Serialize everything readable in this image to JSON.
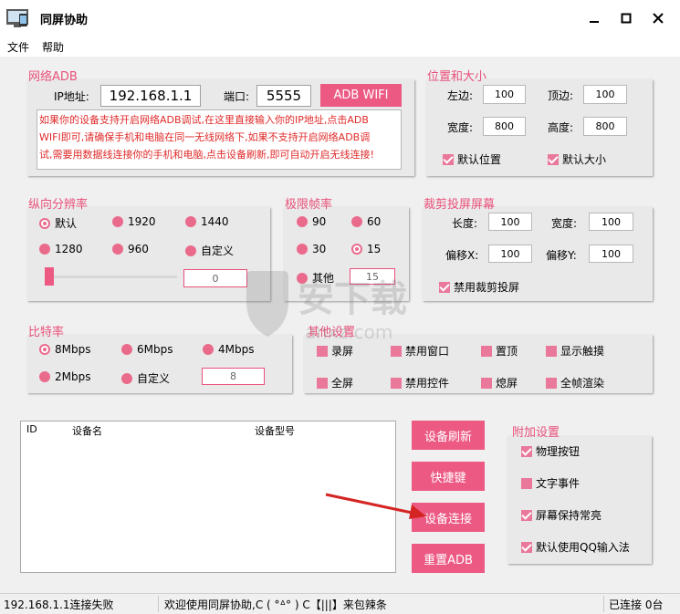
{
  "window": {
    "title": "同屏协助"
  },
  "menu": {
    "file": "文件",
    "help": "帮助"
  },
  "adb": {
    "title": "网络ADB",
    "ip_label": "IP地址:",
    "ip_value": "192.168.1.1",
    "port_label": "端口:",
    "port_value": "5555",
    "button": "ADB WIFI",
    "notice_lines": [
      "如果你的设备支持开启网络ADB调试,在这里直接输入你的IP地址,点击ADB",
      "WIFI即可,请确保手机和电脑在同一无线网络下,如果不支持开启网络ADB调",
      "试,需要用数据线连接你的手机和电脑,点击设备刷新,即可自动开启无线连接!"
    ]
  },
  "position": {
    "title": "位置和大小",
    "left_label": "左边:",
    "left_value": "100",
    "top_label": "顶边:",
    "top_value": "100",
    "width_label": "宽度:",
    "width_value": "800",
    "height_label": "高度:",
    "height_value": "800",
    "default_position": "默认位置",
    "default_size": "默认大小"
  },
  "resolution": {
    "title": "纵向分辨率",
    "options": [
      "默认",
      "1920",
      "1440",
      "1280",
      "960",
      "自定义"
    ],
    "selected": "默认",
    "custom_value": "0",
    "slider_fraction": 0
  },
  "fps": {
    "title": "极限帧率",
    "options": [
      "90",
      "60",
      "30",
      "15",
      "其他"
    ],
    "selected": "15",
    "custom_value": "15"
  },
  "crop": {
    "title": "裁剪投屏屏幕",
    "length_label": "长度:",
    "length_value": "100",
    "width_label": "宽度:",
    "width_value": "100",
    "offsetx_label": "偏移X:",
    "offsetx_value": "100",
    "offsety_label": "偏移Y:",
    "offsety_value": "100",
    "disable_crop": "禁用裁剪投屏"
  },
  "bitrate": {
    "title": "比特率",
    "options": [
      "8Mbps",
      "6Mbps",
      "4Mbps",
      "2Mbps",
      "自定义"
    ],
    "selected": "8Mbps",
    "custom_value": "8"
  },
  "other": {
    "title": "其他设置",
    "options": [
      "录屏",
      "禁用窗口",
      "置顶",
      "显示触摸",
      "全屏",
      "禁用控件",
      "熄屏",
      "全帧渲染"
    ]
  },
  "devices": {
    "col_id": "ID",
    "col_name": "设备名",
    "col_model": "设备型号"
  },
  "actions": {
    "refresh": "设备刷新",
    "shortcut": "快捷键",
    "connect": "设备连接",
    "reset": "重置ADB"
  },
  "extra": {
    "title": "附加设置",
    "physical_buttons": "物理按钮",
    "text_events": "文字事件",
    "keep_awake": "屏幕保持常亮",
    "qq_input": "默认使用QQ输入法"
  },
  "status": {
    "left": "192.168.1.1连接失败",
    "center": "欢迎使用同屏协助,C ( °ᐞ° ) C【|||】来包辣条",
    "right": "已连接 0台"
  },
  "colors": {
    "accent": "#ec5a84",
    "panel_title": "#e8507a",
    "notice_text": "#e02a2a"
  },
  "watermark": {
    "text": "安下载",
    "sub": "anxz.com"
  }
}
